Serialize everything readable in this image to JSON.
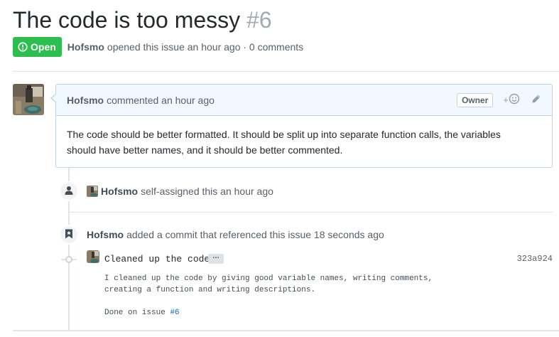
{
  "issue": {
    "title": "The code is too messy",
    "number": "#6",
    "state": "Open",
    "author": "Hofsmo",
    "summary": "opened this issue an hour ago · 0 comments"
  },
  "comment": {
    "author": "Hofsmo",
    "time": "commented an hour ago",
    "owner_label": "Owner",
    "reaction_plus": "+",
    "body": "The code should be better formatted. It should be split up into separate function calls, the variables should have better names, and it should be better commented."
  },
  "events": {
    "assign": {
      "author": "Hofsmo",
      "text": "self-assigned this an hour ago"
    },
    "commit": {
      "author": "Hofsmo",
      "text": "added a commit that referenced this issue 18 seconds ago",
      "message": "Cleaned up the code",
      "ellipsis": "…",
      "sha": "323a924",
      "desc_line1": "I cleaned up the code by giving good variable names, writing comments,",
      "desc_line2": "creating a function and writing descriptions.",
      "desc_line3": "Done on issue",
      "issue_ref": "#6"
    }
  },
  "colors": {
    "open_green": "#2cbe4e",
    "link_blue": "#0366d6",
    "comment_header_bg": "#f1f8ff"
  },
  "icons": [
    "issue-opened-icon",
    "smiley-icon",
    "pencil-icon",
    "person-icon",
    "bookmark-icon",
    "git-commit-icon"
  ]
}
